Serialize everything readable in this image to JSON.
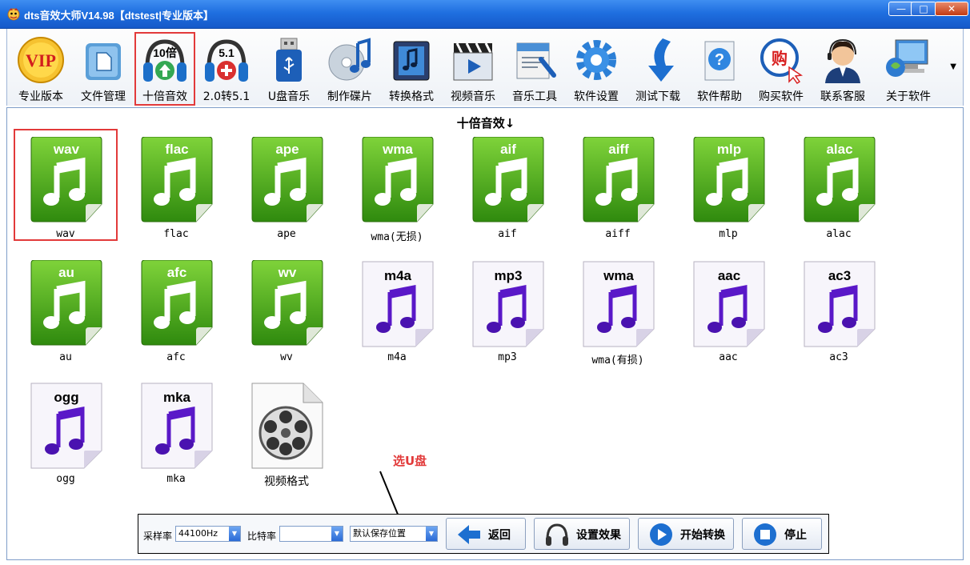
{
  "window": {
    "title": "dts音效大师V14.98【dtstest|专业版本】",
    "minimize": "—",
    "maximize": "□",
    "close": "✕"
  },
  "toolbar": {
    "items": [
      {
        "label": "专业版本",
        "icon": "vip-badge-icon",
        "badge": "VIP"
      },
      {
        "label": "文件管理",
        "icon": "file-manager-icon"
      },
      {
        "label": "十倍音效",
        "icon": "headphones-10x-icon",
        "badge": "10倍",
        "selected": true
      },
      {
        "label": "2.0转5.1",
        "icon": "headphones-51-icon",
        "badge": "5.1"
      },
      {
        "label": "U盘音乐",
        "icon": "usb-drive-icon"
      },
      {
        "label": "制作碟片",
        "icon": "disc-music-icon"
      },
      {
        "label": "转换格式",
        "icon": "convert-format-icon"
      },
      {
        "label": "视频音乐",
        "icon": "video-clapper-icon"
      },
      {
        "label": "音乐工具",
        "icon": "music-tools-icon"
      },
      {
        "label": "软件设置",
        "icon": "gear-icon"
      },
      {
        "label": "测试下载",
        "icon": "download-arrow-icon"
      },
      {
        "label": "软件帮助",
        "icon": "help-icon"
      },
      {
        "label": "购买软件",
        "icon": "buy-icon",
        "badge": "购"
      },
      {
        "label": "联系客服",
        "icon": "support-agent-icon"
      },
      {
        "label": "关于软件",
        "icon": "about-computer-icon"
      }
    ]
  },
  "content": {
    "section_title": "十倍音效↓",
    "formats": [
      {
        "title": "wav",
        "label": "wav",
        "style": "green",
        "selected": true
      },
      {
        "title": "flac",
        "label": "flac",
        "style": "green"
      },
      {
        "title": "ape",
        "label": "ape",
        "style": "green"
      },
      {
        "title": "wma",
        "label": "wma(无损)",
        "style": "green"
      },
      {
        "title": "aif",
        "label": "aif",
        "style": "green"
      },
      {
        "title": "aiff",
        "label": "aiff",
        "style": "green"
      },
      {
        "title": "mlp",
        "label": "mlp",
        "style": "green"
      },
      {
        "title": "alac",
        "label": "alac",
        "style": "green"
      },
      {
        "title": "au",
        "label": "au",
        "style": "green"
      },
      {
        "title": "afc",
        "label": "afc",
        "style": "green"
      },
      {
        "title": "wv",
        "label": "wv",
        "style": "green"
      },
      {
        "title": "m4a",
        "label": "m4a",
        "style": "purple"
      },
      {
        "title": "mp3",
        "label": "mp3",
        "style": "purple"
      },
      {
        "title": "wma",
        "label": "wma(有损)",
        "style": "purple"
      },
      {
        "title": "aac",
        "label": "aac",
        "style": "purple"
      },
      {
        "title": "ac3",
        "label": "ac3",
        "style": "purple"
      },
      {
        "title": "ogg",
        "label": "ogg",
        "style": "purple"
      },
      {
        "title": "mka",
        "label": "mka",
        "style": "purple"
      },
      {
        "title": "",
        "label": "视频格式",
        "style": "film"
      }
    ],
    "annotation": "选U盘"
  },
  "bottom": {
    "sample_rate_label": "采样率",
    "sample_rate_value": "44100Hz",
    "bitrate_label": "比特率",
    "bitrate_value": "",
    "save_location_value": "默认保存位置",
    "back_button": "返回",
    "effects_button": "设置效果",
    "convert_button": "开始转换",
    "stop_button": "停止"
  },
  "colors": {
    "titlebar": "#1f6fe0",
    "highlight": "#e23a3a",
    "green_doc": "#3fa012",
    "purple_note": "#6a1fd0"
  }
}
